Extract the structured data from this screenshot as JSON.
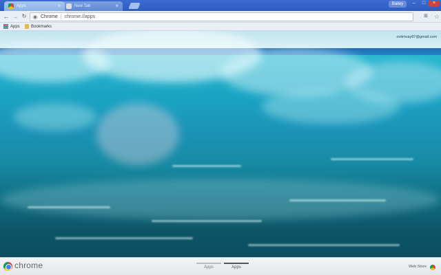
{
  "tabs": [
    {
      "label": "Apps",
      "active": true
    },
    {
      "label": "New Tab",
      "active": false
    }
  ],
  "window": {
    "profile_label": "Bailey",
    "minimize": "–",
    "maximize": "□",
    "close": "×"
  },
  "toolbar": {
    "back": "←",
    "forward": "→",
    "reload": "↻",
    "site_label": "Chrome",
    "separator": "|",
    "url": "chrome://apps",
    "star": "☆",
    "menu": "≡"
  },
  "bookmarks": {
    "apps_label": "Apps",
    "bookmarks_label": "Bookmarks"
  },
  "account": {
    "email": "ovtimvay87@gmail.com"
  },
  "bottom_bar": {
    "brand": "chrome",
    "page_tabs": [
      {
        "label": "Apps",
        "active": false
      },
      {
        "label": "Apps",
        "active": true
      }
    ],
    "webstore_label": "Web Store"
  },
  "colors": {
    "tab_strip": "#2e5dc2",
    "toolbar": "#eaeef5",
    "close_button": "#c8473c"
  },
  "icons": {
    "tab_icon": "apps-icon",
    "omnibox_icon": "chrome-page-icon",
    "bookmark_apps": "apps-grid-icon",
    "bookmark_folder": "folder-icon",
    "bottom_logo": "chrome-logo-icon",
    "webstore": "webstore-icon"
  }
}
